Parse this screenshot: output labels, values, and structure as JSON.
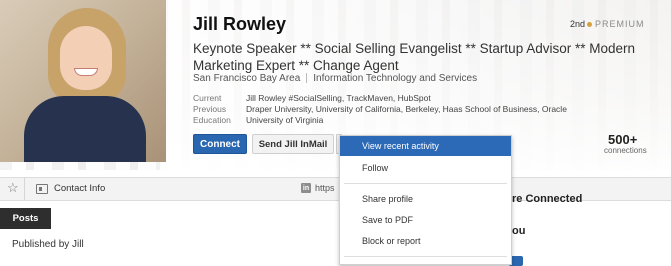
{
  "profile": {
    "name": "Jill Rowley",
    "degree": "2nd",
    "degree_sup": "",
    "premium_label": "PREMIUM",
    "headline": "Keynote Speaker ** Social Selling Evangelist ** Startup Advisor ** Modern Marketing Expert ** Change Agent",
    "location": "San Francisco Bay Area",
    "industry": "Information Technology and Services",
    "details": [
      {
        "label": "Current",
        "value": "Jill Rowley #SocialSelling, TrackMaven, HubSpot"
      },
      {
        "label": "Previous",
        "value": "Draper University, University of California, Berkeley, Haas School of Business, Oracle"
      },
      {
        "label": "Education",
        "value": "University of Virginia"
      }
    ],
    "connect_label": "Connect",
    "inmail_label": "Send Jill InMail",
    "connections_count": "500+",
    "connections_label": "connections"
  },
  "toolbar": {
    "star_icon": "star-icon",
    "contact_label": "Contact Info",
    "in_label": "in",
    "url_text": "https"
  },
  "content": {
    "posts_tab": "Posts",
    "published_by": "Published by Jill",
    "side_heading_1": "re Connected",
    "side_heading_2": "ou"
  },
  "menu": {
    "items": [
      {
        "label": "View recent activity",
        "active": true
      },
      {
        "label": "Follow"
      },
      {
        "label": "Share profile"
      },
      {
        "label": "Save to PDF"
      },
      {
        "label": "Block or report"
      }
    ]
  },
  "colors": {
    "accent": "#2a67b1",
    "menu_highlight": "#2c6ab7",
    "premium_gold": "#d4a13a"
  }
}
